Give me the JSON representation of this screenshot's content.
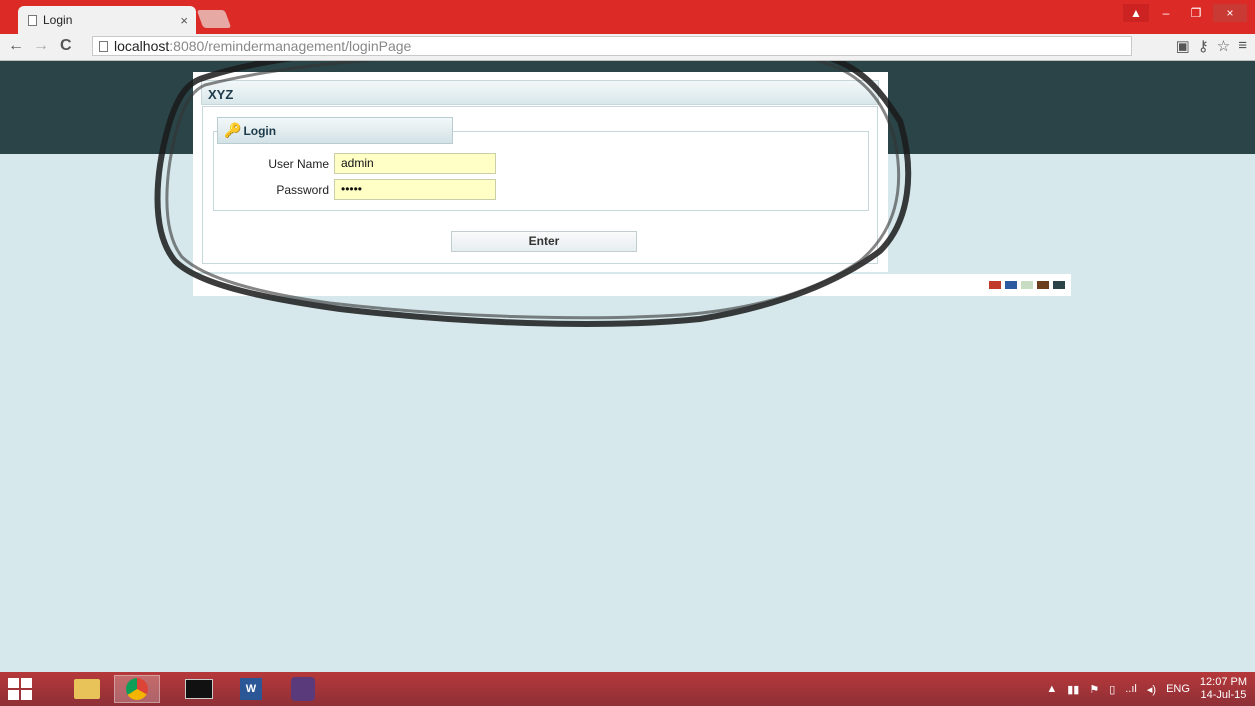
{
  "browser": {
    "tab_title": "Login",
    "tab_close": "×",
    "url_host": "localhost",
    "url_path": ":8080/remindermanagement/loginPage",
    "back": "←",
    "forward": "→",
    "reload": "C",
    "menu_icon": "≡",
    "star_icon": "☆"
  },
  "app": {
    "brand": "XYZ"
  },
  "login": {
    "legend": "Login",
    "username_label": "User Name",
    "username_value": "admin",
    "password_label": "Password",
    "password_value": "•••••",
    "enter_label": "Enter"
  },
  "swatches": [
    "#c0392b",
    "#2c5aa0",
    "#c8dcc4",
    "#6b3e1e",
    "#2b4448"
  ],
  "colors": {
    "header": "#2b4448",
    "page": "#d6e8ec",
    "titlebar": "#dc2a26",
    "input": "#ffffc6"
  },
  "taskbar": {
    "lang": "ENG",
    "time": "12:07 PM",
    "date": "14-Jul-15"
  }
}
